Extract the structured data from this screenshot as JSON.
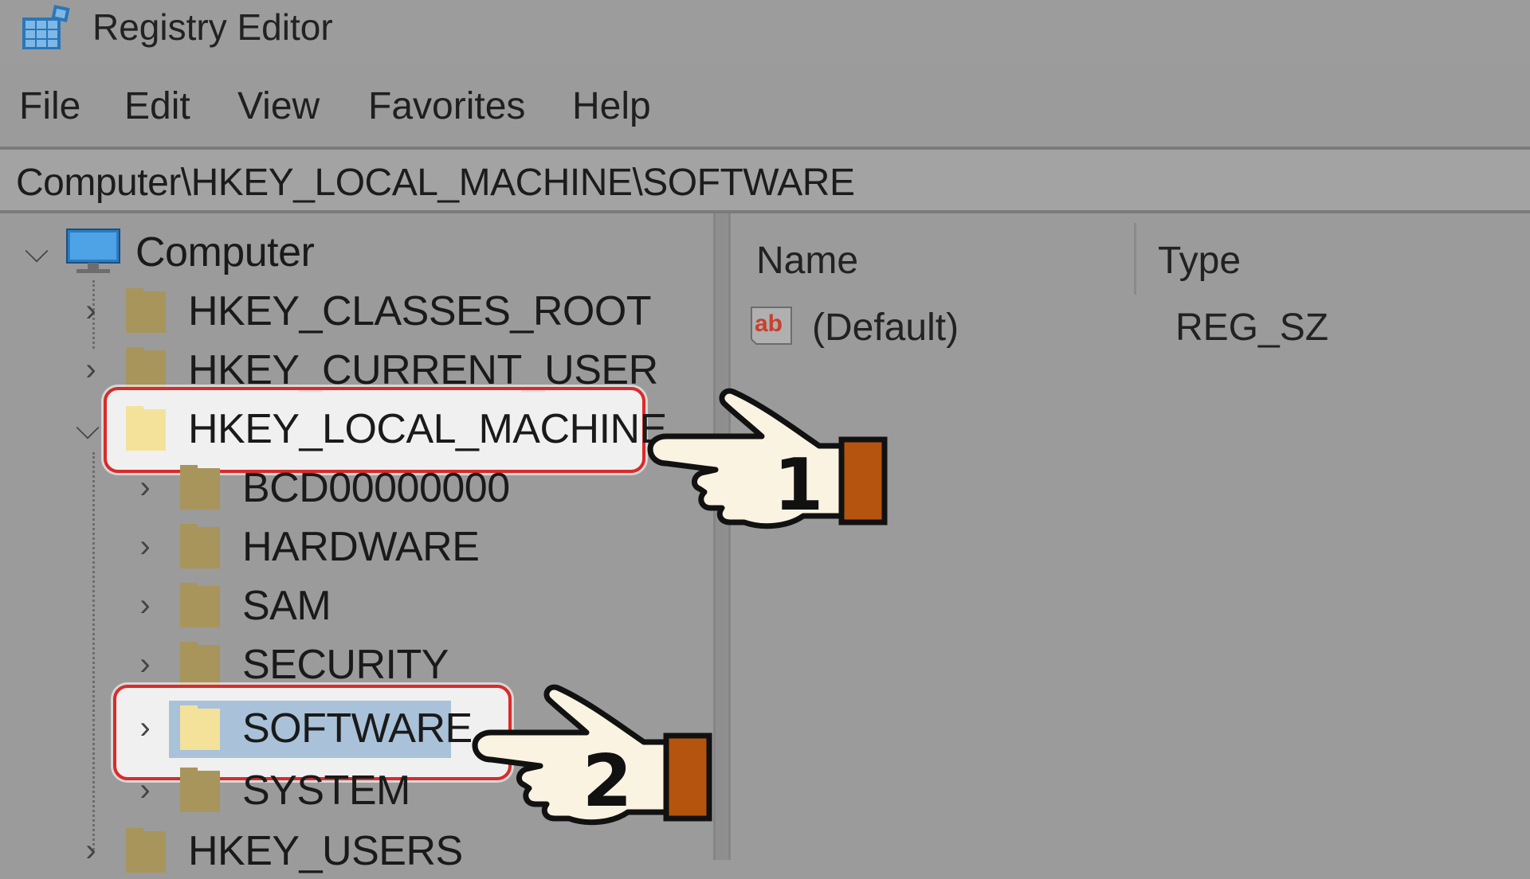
{
  "window": {
    "title": "Registry Editor",
    "icon": "registry-editor-icon"
  },
  "menu": [
    "File",
    "Edit",
    "View",
    "Favorites",
    "Help"
  ],
  "address": "Computer\\HKEY_LOCAL_MACHINE\\SOFTWARE",
  "tree": {
    "root": "Computer",
    "hives": [
      "HKEY_CLASSES_ROOT",
      "HKEY_CURRENT_USER",
      "HKEY_LOCAL_MACHINE"
    ],
    "hklm_children": [
      "BCD00000000",
      "HARDWARE",
      "SAM",
      "SECURITY",
      "SOFTWARE",
      "SYSTEM"
    ],
    "last_hive": "HKEY_USERS",
    "selected": "SOFTWARE"
  },
  "values_pane": {
    "columns": [
      "Name",
      "Type"
    ],
    "rows": [
      {
        "name": "(Default)",
        "type": "REG_SZ",
        "icon": "string-value-icon"
      }
    ]
  },
  "annotations": [
    "1",
    "2"
  ],
  "colors": {
    "highlight_border": "#d92b2b",
    "selection": "#a9c2d9",
    "hand_cuff": "#b5540e"
  }
}
